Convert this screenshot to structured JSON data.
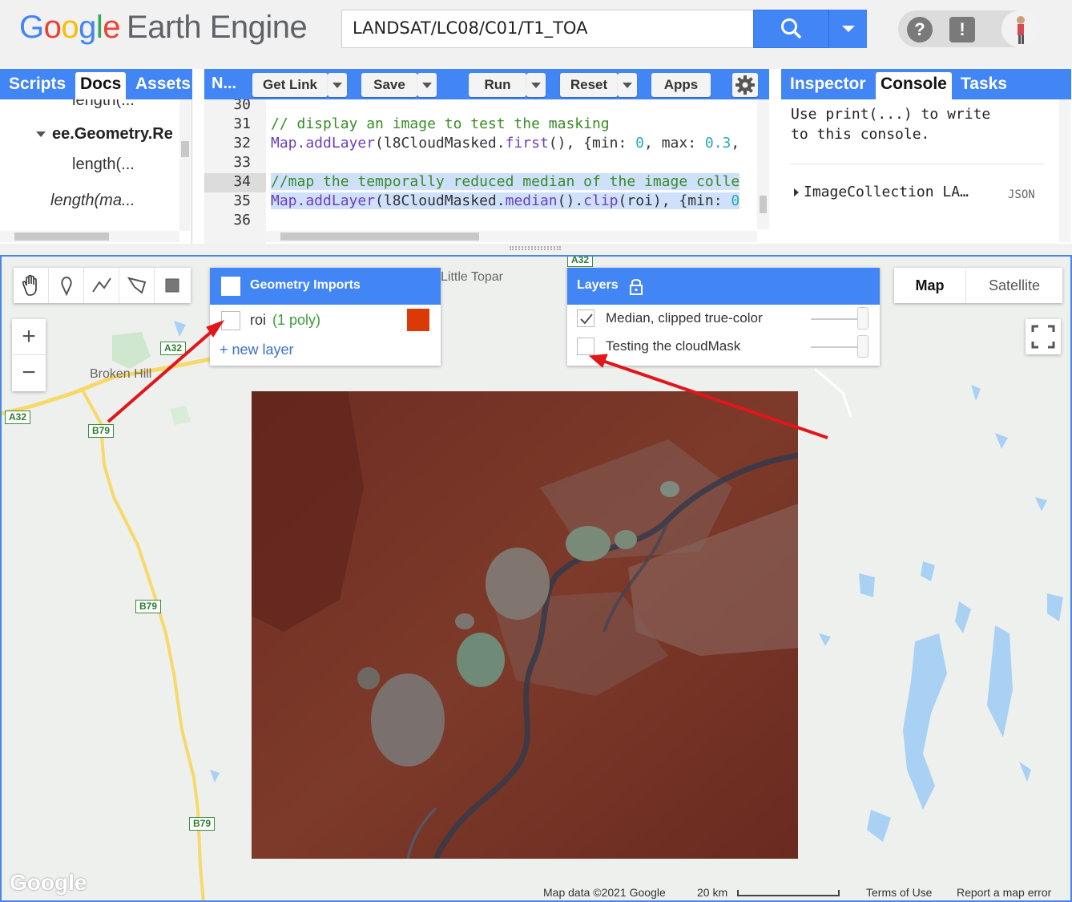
{
  "app": {
    "logo_google": [
      "G",
      "o",
      "o",
      "g",
      "l",
      "e"
    ],
    "logo_rest": "Earth Engine",
    "search_value": "LANDSAT/LC08/C01/T1_TOA"
  },
  "left_tabs": [
    "Scripts",
    "Docs",
    "Assets"
  ],
  "docs": {
    "line_top": "length(...",
    "class_name": "ee.Geometry.Re",
    "item1": "length(...",
    "item2": "length(ma..."
  },
  "editor_toolbar": {
    "tab_title": "N...",
    "get_link": "Get Link",
    "save": "Save",
    "run": "Run",
    "reset": "Reset",
    "apps": "Apps"
  },
  "editor": {
    "line_numbers": [
      "30",
      "31",
      "32",
      "33",
      "34",
      "35",
      "36"
    ],
    "line31": "// display an image to test the masking",
    "line32": [
      {
        "t": "Map.addLayer",
        "c": "fn"
      },
      {
        "t": "(l8CloudMasked.",
        "c": ""
      },
      {
        "t": "first",
        "c": "fn"
      },
      {
        "t": "(), {min: ",
        "c": ""
      },
      {
        "t": "0",
        "c": "num"
      },
      {
        "t": ", max: ",
        "c": ""
      },
      {
        "t": "0.3",
        "c": "num"
      },
      {
        "t": ",",
        "c": ""
      }
    ],
    "line34": "//map the temporally reduced median of the image colle",
    "line35": [
      {
        "t": "Map.addLayer",
        "c": "fn"
      },
      {
        "t": "(l8CloudMasked.",
        "c": ""
      },
      {
        "t": "median",
        "c": "fn"
      },
      {
        "t": "().",
        "c": ""
      },
      {
        "t": "clip",
        "c": "fn"
      },
      {
        "t": "(roi), {min: ",
        "c": ""
      },
      {
        "t": "0",
        "c": "num"
      }
    ]
  },
  "right_tabs": [
    "Inspector",
    "Console",
    "Tasks"
  ],
  "console": {
    "hint_line1": "Use print(...) to write",
    "hint_line2": "to this console.",
    "entry": "ImageCollection LA…",
    "entry_badge": "JSON"
  },
  "geometry_imports": {
    "title": "Geometry Imports",
    "layer_name": "roi",
    "layer_count": "(1 poly)",
    "layer_color": "#d93a06",
    "new_layer": "+ new layer"
  },
  "layers_panel": {
    "title": "Layers",
    "items": [
      {
        "label": "Median, clipped true-color",
        "checked": true
      },
      {
        "label": "Testing the cloudMask",
        "checked": false
      }
    ]
  },
  "map_type": {
    "map": "Map",
    "satellite": "Satellite"
  },
  "map_labels": {
    "town1": "Little Topar",
    "town2": "Broken Hill",
    "road_a32": "A32",
    "road_b79": "B79"
  },
  "footer": {
    "map_data": "Map data ©2021 Google",
    "scale": "20 km",
    "terms": "Terms of Use",
    "report": "Report a map error",
    "watermark": "Google"
  },
  "colors": {
    "accent": "#4285f4",
    "annotation_arrow": "#e0161b",
    "image_base": "#6e2e22"
  }
}
